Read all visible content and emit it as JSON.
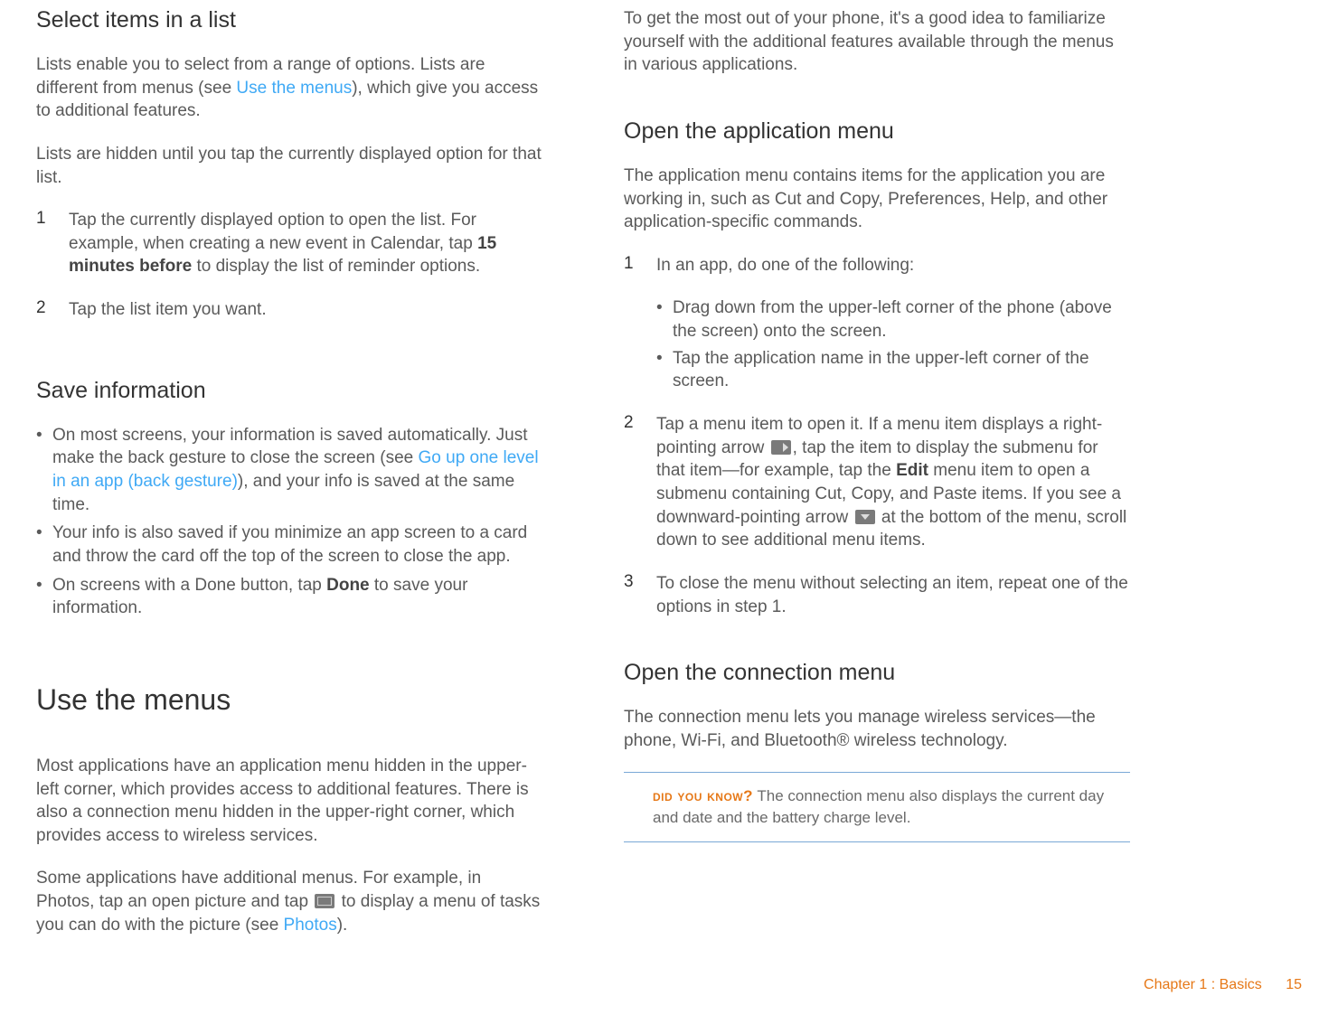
{
  "left": {
    "selectItems": {
      "heading": "Select items in a list",
      "p1a": "Lists enable you to select from a range of options. Lists are different from menus (see ",
      "p1_link": "Use the menus",
      "p1b": "), which give you access to additional features.",
      "p2": "Lists are hidden until you tap the currently displayed option for that list.",
      "step1a": "Tap the currently displayed option to open the list. For example, when creating a new event in Calendar, tap ",
      "step1_bold": "15 minutes before",
      "step1b": " to display the list of reminder options.",
      "step2": "Tap the list item you want."
    },
    "saveInfo": {
      "heading": "Save information",
      "b1a": "On most screens, your information is saved automatically. Just make the back gesture to close the screen (see ",
      "b1_link": "Go up one level in an app (back gesture)",
      "b1b": "), and your info is saved at the same time.",
      "b2": "Your info is also saved if you minimize an app screen to a card and throw the card off the top of the screen to close the app.",
      "b3a": "On screens with a Done button, tap ",
      "b3_bold": "Done",
      "b3b": " to save your information."
    },
    "useMenus": {
      "heading": "Use the menus",
      "p1": "Most applications have an application menu hidden in the upper-left corner, which provides access to additional features. There is also a connection menu hidden in the upper-right corner, which provides access to wireless services.",
      "p2a": "Some applications have additional menus. For example, in Photos, tap an open picture and tap ",
      "p2b": " to display a menu of tasks you can do with the picture (see ",
      "p2_link": "Photos",
      "p2c": ")."
    }
  },
  "right": {
    "intro": "To get the most out of your phone, it's a good idea to familiarize yourself with the additional features available through the menus in various applications.",
    "openApp": {
      "heading": "Open the application menu",
      "p1": "The application menu contains items for the application you are working in, such as Cut and Copy, Preferences, Help, and other application-specific commands.",
      "s1": "In an app, do one of the following:",
      "s1_b1": "Drag down from the upper-left corner of the phone (above the screen) onto the screen.",
      "s1_b2": "Tap the application name in the upper-left corner of the screen.",
      "s2a": "Tap a menu item to open it. If a menu item displays a right-pointing arrow ",
      "s2b": ", tap the item to display the submenu for that item—for example, tap the ",
      "s2_bold": "Edit",
      "s2c": " menu item to open a submenu containing Cut, Copy, and Paste items. If you see a downward-pointing arrow ",
      "s2d": " at the bottom of the menu, scroll down to see additional menu items.",
      "s3": "To close the menu without selecting an item, repeat one of the options in step 1."
    },
    "openConn": {
      "heading": "Open the connection menu",
      "p1": "The connection menu lets you manage wireless services—the phone, Wi-Fi, and Bluetooth® wireless technology.",
      "callout_label": "DID YOU KNOW?",
      "callout_text": "  The connection menu also displays the current day and date and the battery charge level."
    }
  },
  "footer": {
    "chapter": "Chapter 1 : Basics",
    "page": "15"
  }
}
